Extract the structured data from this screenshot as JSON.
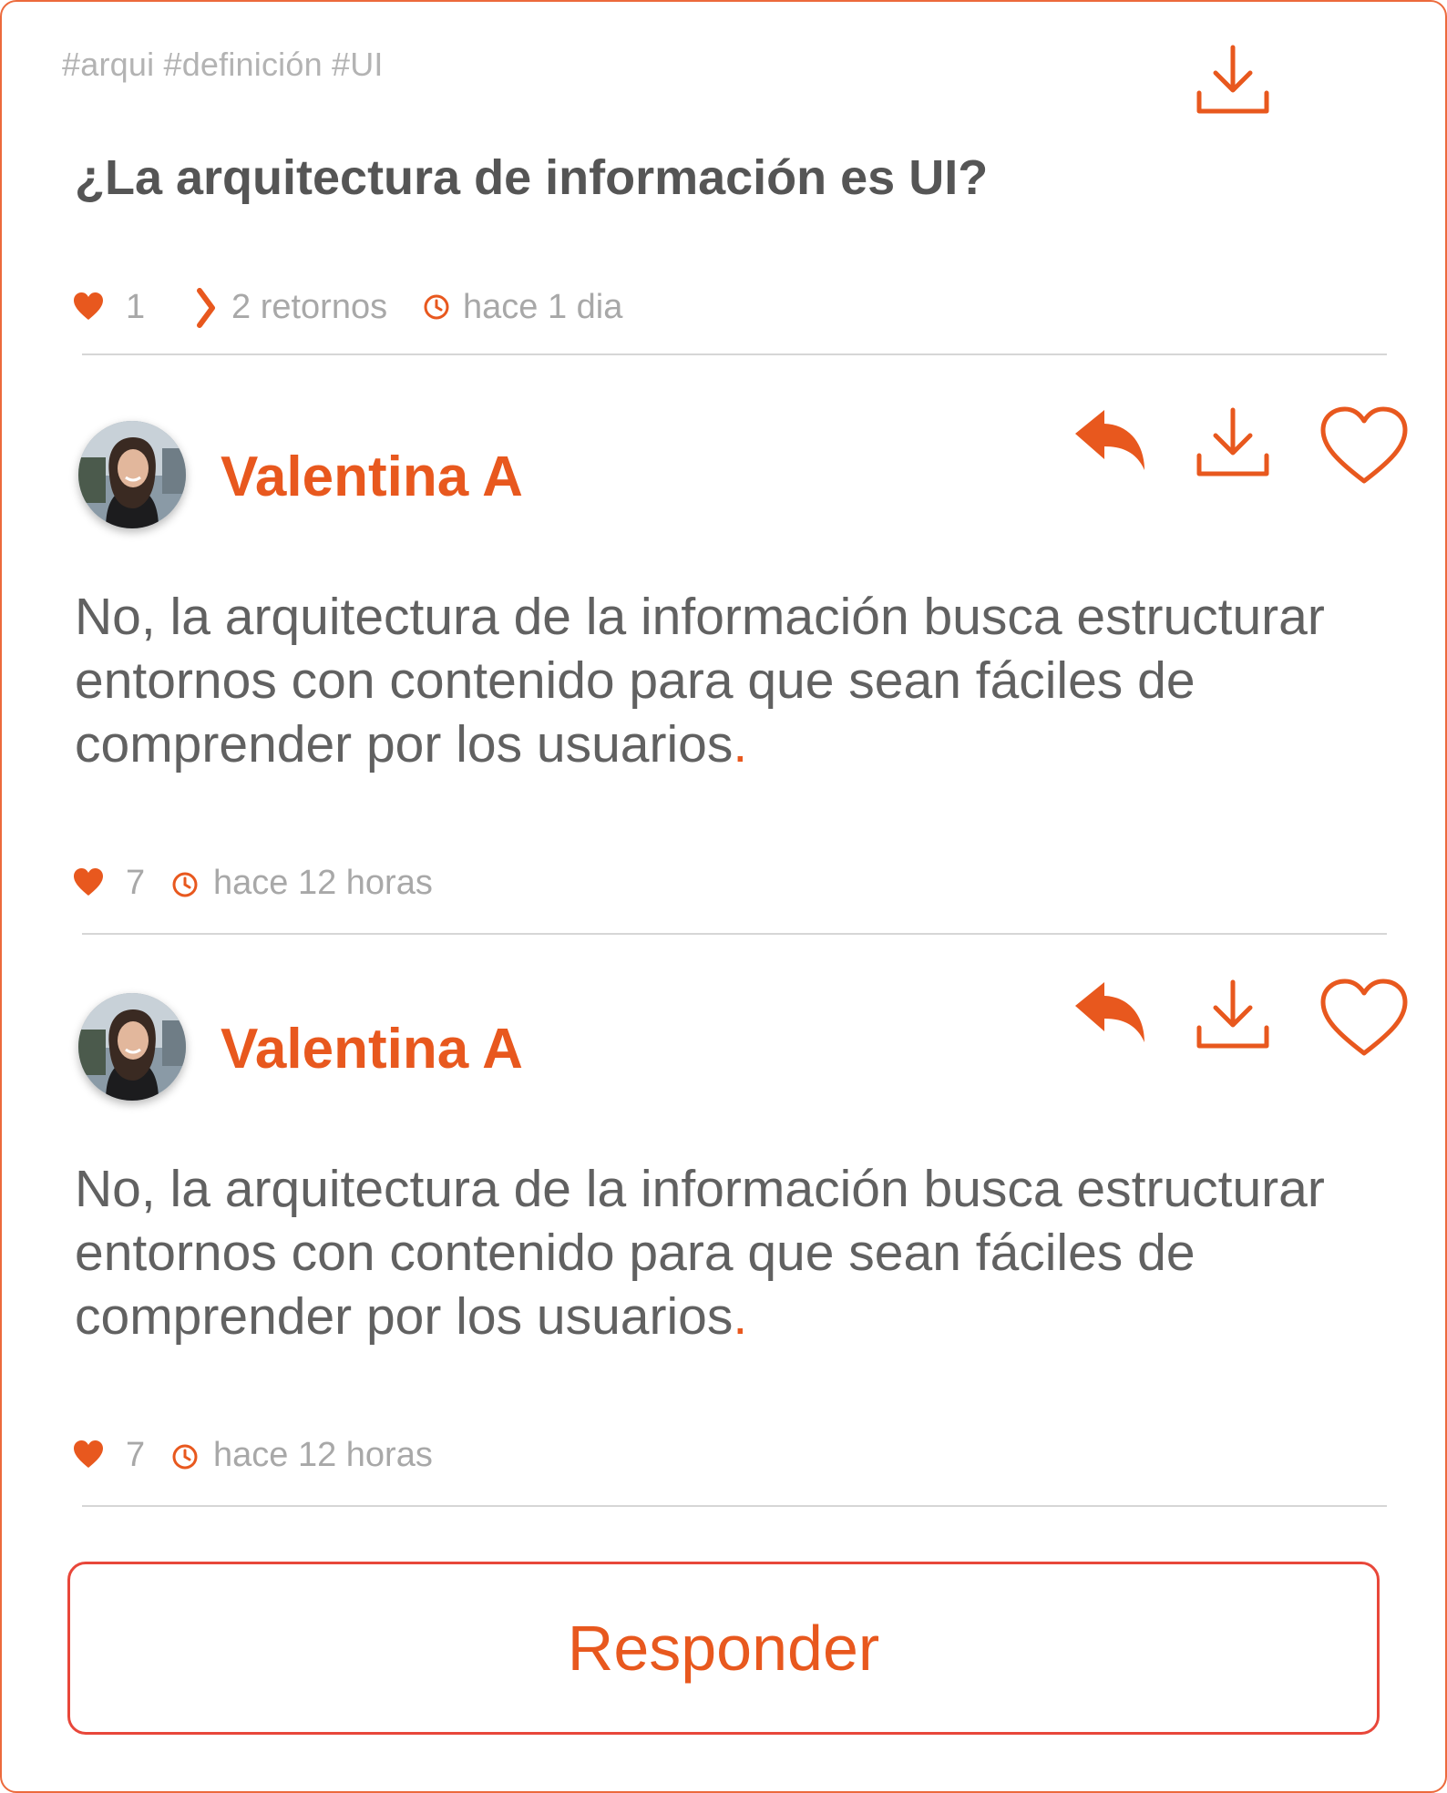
{
  "colors": {
    "accent": "#e8581e",
    "border": "#ec6a3c",
    "muted_text": "#a8a8a8",
    "divider": "#d6d6d6"
  },
  "post": {
    "tags": "#arqui #definición #UI",
    "title": "¿La arquitectura de información es UI?",
    "likes": "1",
    "replies": "2 retornos",
    "time": "hace 1 dia",
    "icons": {
      "download": "download-icon",
      "like": "heart-icon",
      "replies": "chevron-right-icon",
      "time": "clock-icon"
    }
  },
  "comments": [
    {
      "author": "Valentina A",
      "text": "No, la arquitectura de la información busca estructurar entornos con contenido para que sean fáciles de comprender por los usuarios",
      "period": ".",
      "likes": "7",
      "time": "hace 12 horas"
    },
    {
      "author": "Valentina A",
      "text": "No, la arquitectura de la información busca estructurar entornos con contenido para que sean fáciles de comprender por los usuarios",
      "period": ".",
      "likes": "7",
      "time": "hace 12 horas"
    }
  ],
  "reply_button": {
    "label": "Responder"
  }
}
